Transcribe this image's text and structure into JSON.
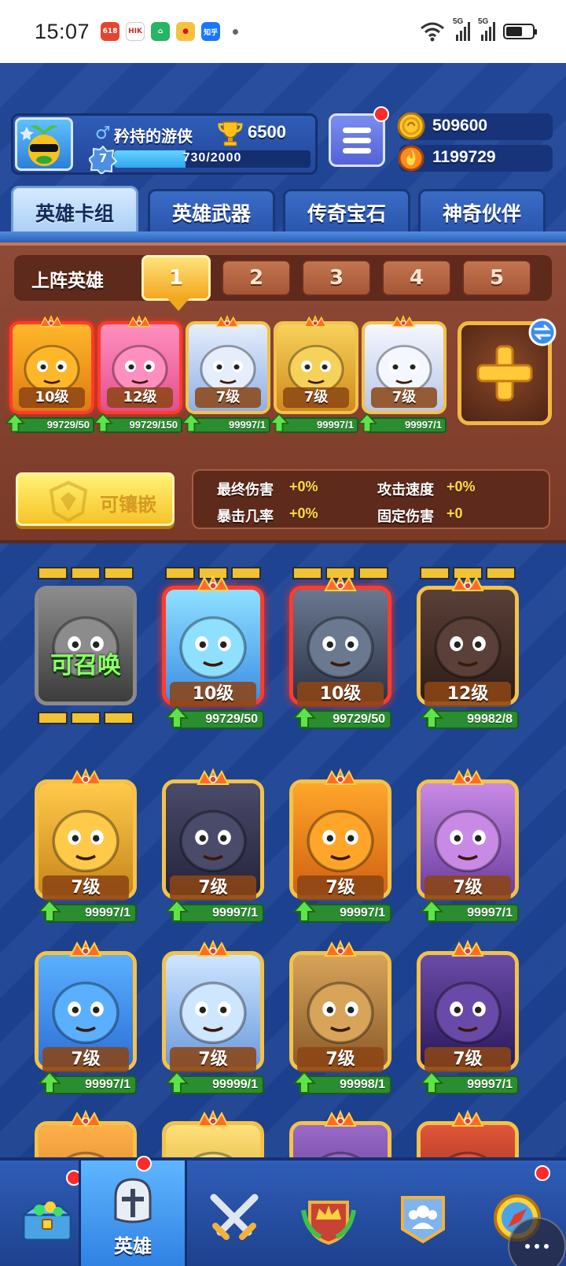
{
  "status_bar": {
    "time": "15:07",
    "apps": [
      "app-618",
      "HIKVISION",
      "home-app",
      "weibo",
      "知乎"
    ],
    "network": [
      "5G",
      "5G"
    ]
  },
  "player": {
    "gender_symbol": "♂",
    "name": "矜持的游侠",
    "trophies": "6500",
    "level": "7",
    "xp_text": "730/2000",
    "xp_fraction": 0.365
  },
  "currencies": [
    {
      "icon": "gold-coin-icon",
      "value": "509600"
    },
    {
      "icon": "fire-gem-icon",
      "value": "1199729"
    }
  ],
  "tabs": [
    {
      "label": "英雄卡组",
      "active": true
    },
    {
      "label": "英雄武器",
      "active": false
    },
    {
      "label": "传奇宝石",
      "active": false
    },
    {
      "label": "神奇伙伴",
      "active": false
    }
  ],
  "lineup": {
    "label": "上阵英雄",
    "slots": [
      "1",
      "2",
      "3",
      "4",
      "5"
    ],
    "active_slot": "1"
  },
  "deck_cards": [
    {
      "level": "10级",
      "progress": "99729/50",
      "frame": "red",
      "hero": "golden-king"
    },
    {
      "level": "12级",
      "progress": "99729/150",
      "frame": "red",
      "hero": "pink-blob"
    },
    {
      "level": "7级",
      "progress": "99997/1",
      "frame": "gold",
      "hero": "clown"
    },
    {
      "level": "7级",
      "progress": "99997/1",
      "frame": "gold",
      "hero": "mustache-duck"
    },
    {
      "level": "7级",
      "progress": "99997/1",
      "frame": "gold",
      "hero": "ghost"
    }
  ],
  "embed_button": {
    "label": "可镶嵌"
  },
  "stats": [
    {
      "label": "最终伤害",
      "value": "+0%"
    },
    {
      "label": "攻击速度",
      "value": "+0%"
    },
    {
      "label": "暴击几率",
      "value": "+0%"
    },
    {
      "label": "固定伤害",
      "value": "+0"
    }
  ],
  "hero_grid": [
    {
      "level": "",
      "progress": "",
      "frame": "gray",
      "summon": "可召唤",
      "hero": "skull-knight"
    },
    {
      "level": "10级",
      "progress": "99729/50",
      "frame": "red",
      "hero": "ice-mage"
    },
    {
      "level": "10级",
      "progress": "99729/50",
      "frame": "red",
      "hero": "dark-knight"
    },
    {
      "level": "12级",
      "progress": "99982/8",
      "frame": "gold",
      "hero": "lava-golem"
    },
    {
      "level": "7级",
      "progress": "99997/1",
      "frame": "gold",
      "hero": "helmet-warrior"
    },
    {
      "level": "7级",
      "progress": "99997/1",
      "frame": "gold",
      "hero": "masked-ninja"
    },
    {
      "level": "7级",
      "progress": "99997/1",
      "frame": "gold",
      "hero": "orange-slime"
    },
    {
      "level": "7级",
      "progress": "99997/1",
      "frame": "gold",
      "hero": "purple-skull"
    },
    {
      "level": "7级",
      "progress": "99997/1",
      "frame": "gold",
      "hero": "pharaoh"
    },
    {
      "level": "7级",
      "progress": "99999/1",
      "frame": "gold",
      "hero": "yeti"
    },
    {
      "level": "7级",
      "progress": "99998/1",
      "frame": "gold",
      "hero": "treant"
    },
    {
      "level": "7级",
      "progress": "99997/1",
      "frame": "gold",
      "hero": "shadow-wizard"
    },
    {
      "level": "",
      "progress": "",
      "frame": "gold",
      "hero": "warrior-partial"
    },
    {
      "level": "",
      "progress": "",
      "frame": "gold",
      "hero": "hooded-partial"
    },
    {
      "level": "",
      "progress": "",
      "frame": "gold",
      "hero": "demon-partial"
    },
    {
      "level": "",
      "progress": "",
      "frame": "gold",
      "hero": "samurai-partial"
    }
  ],
  "bottom_nav": [
    {
      "icon": "treasure-chest-icon",
      "label": ""
    },
    {
      "icon": "knight-helmet-icon",
      "label": "英雄",
      "active": true
    },
    {
      "icon": "crossed-swords-icon",
      "label": ""
    },
    {
      "icon": "crown-shield-icon",
      "label": ""
    },
    {
      "icon": "guild-icon",
      "label": ""
    },
    {
      "icon": "compass-icon",
      "label": ""
    }
  ],
  "colors": {
    "background": "#1d3f8a",
    "deck_panel": "#8f4a36",
    "gold_frame": "#f4c24a",
    "red_frame": "#ff3c2c",
    "progress_green": "#2a8d2f",
    "stat_value": "#ffd94a"
  }
}
